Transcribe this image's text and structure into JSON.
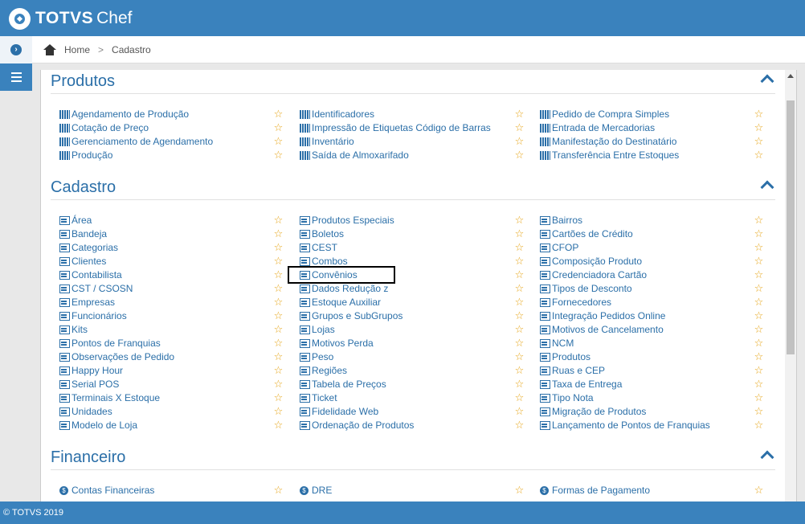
{
  "header": {
    "logo_brand": "TOTVS",
    "logo_product": "Chef"
  },
  "breadcrumb": {
    "home": "Home",
    "separator": ">",
    "current": "Cadastro"
  },
  "sections": [
    {
      "title": "Produtos",
      "icon": "report-icon",
      "columns": [
        [
          "Agendamento de Produção",
          "Cotação de Preço",
          "Gerenciamento de Agendamento",
          "Produção"
        ],
        [
          "Identificadores",
          "Impressão de Etiquetas Código de Barras",
          "Inventário",
          "Saída de Almoxarifado"
        ],
        [
          "Pedido de Compra Simples",
          "Entrada de Mercadorias",
          "Manifestação do Destinatário",
          "Transferência Entre Estoques"
        ]
      ]
    },
    {
      "title": "Cadastro",
      "icon": "form-icon",
      "columns": [
        [
          "Área",
          "Bandeja",
          "Categorias",
          "Clientes",
          "Contabilista",
          "CST / CSOSN",
          "Empresas",
          "Funcionários",
          "Kits",
          "Pontos de Franquias",
          "Observações de Pedido",
          "Happy Hour",
          "Serial POS",
          "Terminais X Estoque",
          "Unidades",
          "Modelo de Loja"
        ],
        [
          "Produtos Especiais",
          "Boletos",
          "CEST",
          "Combos",
          "Convênios",
          "Dados Redução z",
          "Estoque Auxiliar",
          "Grupos e SubGrupos",
          "Lojas",
          "Motivos Perda",
          "Peso",
          "Regiões",
          "Tabela de Preços",
          "Ticket",
          "Fidelidade Web",
          "Ordenação de Produtos"
        ],
        [
          "Bairros",
          "Cartões de Crédito",
          "CFOP",
          "Composição Produto",
          "Credenciadora Cartão",
          "Tipos de Desconto",
          "Fornecedores",
          "Integração Pedidos Online",
          "Motivos de Cancelamento",
          "NCM",
          "Produtos",
          "Ruas e CEP",
          "Taxa de Entrega",
          "Tipo Nota",
          "Migração de Produtos",
          "Lançamento de Pontos de Franquias"
        ]
      ]
    },
    {
      "title": "Financeiro",
      "icon": "money-icon",
      "columns": [
        [
          "Contas Financeiras"
        ],
        [
          "DRE"
        ],
        [
          "Formas de Pagamento"
        ]
      ]
    }
  ],
  "star_glyph": "☆",
  "footer": {
    "copyright": "© TOTVS 2019"
  },
  "colors": {
    "brand": "#3a82bd",
    "link": "#2b6fa8",
    "star": "#e6a517"
  }
}
